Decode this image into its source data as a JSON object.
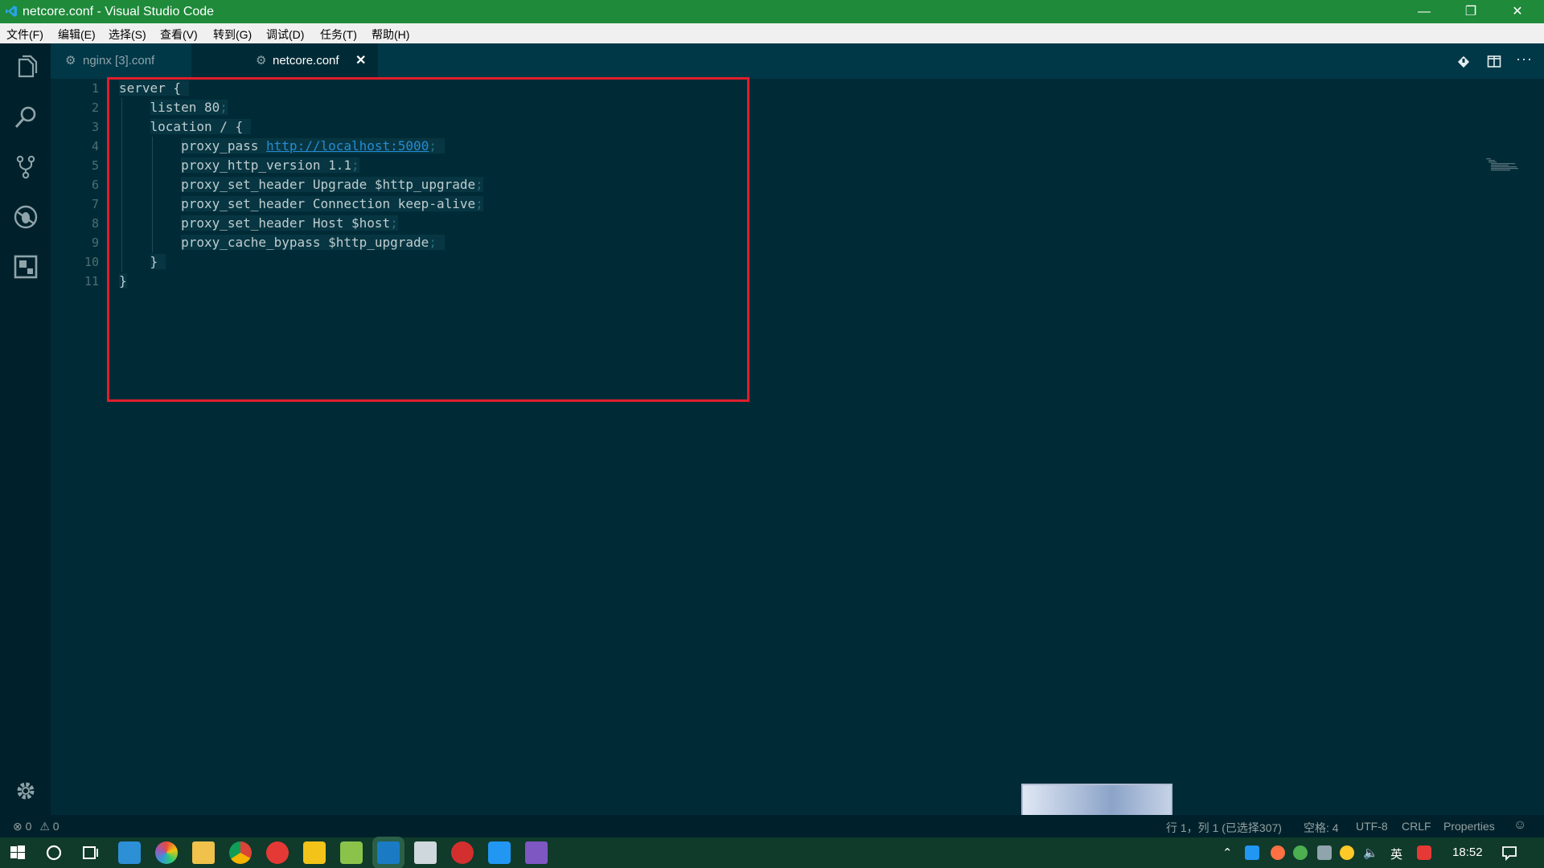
{
  "window": {
    "title": "netcore.conf - Visual Studio Code",
    "accent": "#1e8a3a"
  },
  "menu": [
    "文件(F)",
    "编辑(E)",
    "选择(S)",
    "查看(V)",
    "转到(G)",
    "调试(D)",
    "任务(T)",
    "帮助(H)"
  ],
  "tabs": [
    {
      "label": "nginx [3].conf",
      "active": false
    },
    {
      "label": "netcore.conf",
      "active": true
    }
  ],
  "editor": {
    "line_numbers": [
      "1",
      "2",
      "3",
      "4",
      "5",
      "6",
      "7",
      "8",
      "9",
      "10",
      "11"
    ],
    "lines": [
      {
        "indent": "",
        "text": "server {",
        "semi": ""
      },
      {
        "indent": "    ",
        "text": "listen 80",
        "semi": ";"
      },
      {
        "indent": "    ",
        "text": "location / {",
        "semi": ""
      },
      {
        "indent": "        ",
        "text": "proxy_pass ",
        "url": "http://localhost:5000",
        "semi": ";"
      },
      {
        "indent": "        ",
        "text": "proxy_http_version 1.1",
        "semi": ";"
      },
      {
        "indent": "        ",
        "text": "proxy_set_header Upgrade $http_upgrade",
        "semi": ";"
      },
      {
        "indent": "        ",
        "text": "proxy_set_header Connection keep-alive",
        "semi": ";"
      },
      {
        "indent": "        ",
        "text": "proxy_set_header Host $host",
        "semi": ";"
      },
      {
        "indent": "        ",
        "text": "proxy_cache_bypass $http_upgrade",
        "semi": ";"
      },
      {
        "indent": "    ",
        "text": "}",
        "semi": ""
      },
      {
        "indent": "",
        "text": "}",
        "semi": ""
      }
    ]
  },
  "status": {
    "errors": "0",
    "warnings": "0",
    "position": "行 1，列 1 (已选择307)",
    "indent": "空格: 4",
    "encoding": "UTF-8",
    "eol": "CRLF",
    "language": "Properties"
  },
  "taskbar": {
    "clock": "18:52",
    "ime": "英"
  },
  "icons": {
    "activity": [
      "explorer-icon",
      "search-icon",
      "source-control-icon",
      "debug-icon",
      "extensions-icon",
      "settings-gear-icon"
    ],
    "editor_actions": [
      "open-changes-icon",
      "split-editor-icon",
      "more-actions-icon"
    ]
  }
}
